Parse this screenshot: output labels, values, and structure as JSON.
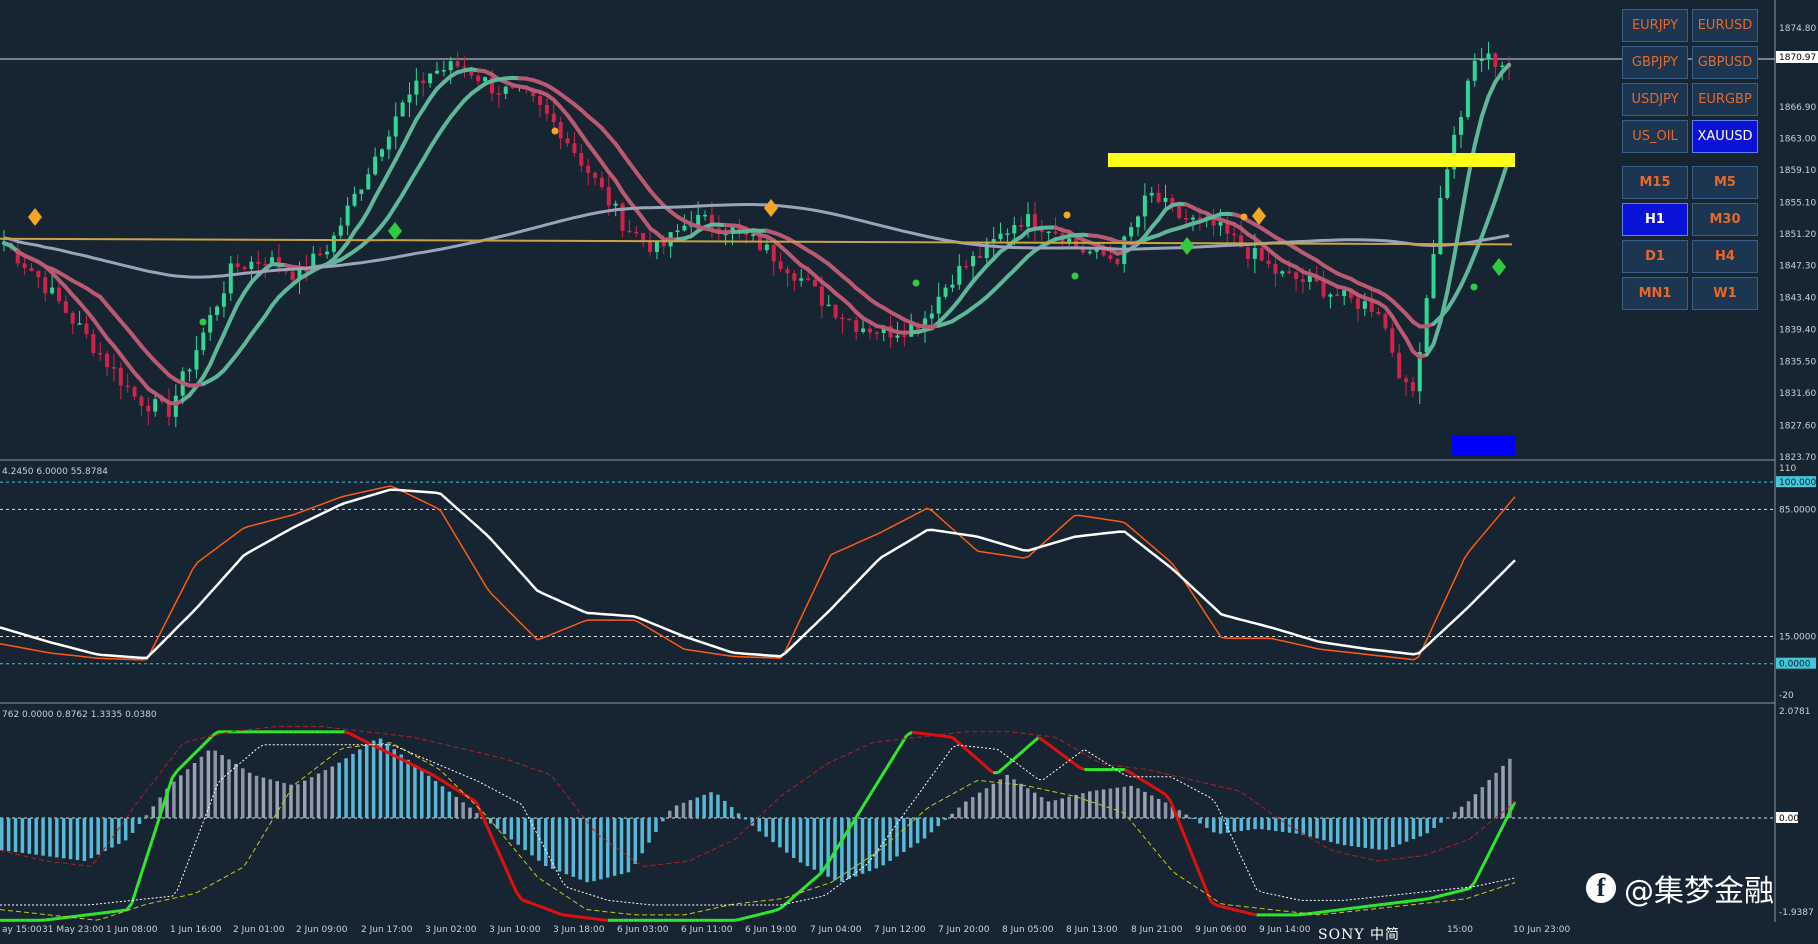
{
  "symbols": [
    {
      "label": "EURJPY",
      "active": false
    },
    {
      "label": "EURUSD",
      "active": false
    },
    {
      "label": "GBPJPY",
      "active": false
    },
    {
      "label": "GBPUSD",
      "active": false
    },
    {
      "label": "USDJPY",
      "active": false
    },
    {
      "label": "EURGBP",
      "active": false
    },
    {
      "label": "US_OIL",
      "active": false
    },
    {
      "label": "XAUUSD",
      "active": true
    }
  ],
  "timeframes": [
    {
      "label": "M15",
      "active": false
    },
    {
      "label": "M5",
      "active": false
    },
    {
      "label": "H1",
      "active": true
    },
    {
      "label": "M30",
      "active": false
    },
    {
      "label": "D1",
      "active": false
    },
    {
      "label": "H4",
      "active": false
    },
    {
      "label": "MN1",
      "active": false
    },
    {
      "label": "W1",
      "active": false
    }
  ],
  "price_axis": {
    "labels": [
      "1874.80",
      "1870.97",
      "1866.90",
      "1863.00",
      "1859.10",
      "1855.10",
      "1851.20",
      "1847.30",
      "1843.40",
      "1839.40",
      "1835.50",
      "1831.60",
      "1827.60",
      "1823.70"
    ],
    "current": "1870.97"
  },
  "stoch_panel": {
    "header": "4.2450 6.0000 55.8784",
    "axis": [
      "110",
      "100.0000",
      "85.0000",
      "15.0000",
      "0.0000",
      "-20"
    ]
  },
  "macd_panel": {
    "header": "762 0.0000 0.8762 1.3335 0.0380",
    "axis": [
      "2.0781",
      "0.00",
      "-1.9387"
    ]
  },
  "time_axis": [
    "ay 15:00",
    "31 May 23:00",
    "1 Jun 08:00",
    "1 Jun 16:00",
    "2 Jun 01:00",
    "2 Jun 09:00",
    "2 Jun 17:00",
    "3 Jun 02:00",
    "3 Jun 10:00",
    "3 Jun 18:00",
    "6 Jun 03:00",
    "6 Jun 11:00",
    "6 Jun 19:00",
    "7 Jun 04:00",
    "7 Jun 12:00",
    "7 Jun 20:00",
    "8 Jun 05:00",
    "8 Jun 13:00",
    "8 Jun 21:00",
    "9 Jun 06:00",
    "9 Jun 14:00",
    "15:00",
    "10 Jun 23:00"
  ],
  "watermark": {
    "text": "@集梦金融",
    "logo": "facebook-icon",
    "overlay": "SONY 中简"
  },
  "colors": {
    "bg": "#172532",
    "bull": "#2fd894",
    "bear": "#d1234a",
    "signal_yellow": "#ffff1a",
    "signal_blue": "#0000ff",
    "diamond": "#f5a623",
    "diamond_green": "#2ecc40"
  },
  "chart_data": {
    "type": "candlestick",
    "symbol": "XAUUSD",
    "timeframe": "H1",
    "ylim": [
      1823.7,
      1876.5
    ],
    "price_keypoints": [
      1850,
      1846,
      1841,
      1836,
      1831,
      1829,
      1838,
      1847,
      1848,
      1846,
      1850,
      1858,
      1866,
      1871,
      1872,
      1869,
      1868,
      1864,
      1858,
      1852,
      1849,
      1853,
      1852,
      1850,
      1847,
      1843,
      1840,
      1839,
      1840,
      1846,
      1849,
      1853,
      1852,
      1849,
      1848,
      1856,
      1853,
      1852,
      1849,
      1846,
      1845,
      1843,
      1842,
      1830,
      1858,
      1873,
      1872
    ],
    "stochastic": {
      "levels": [
        100,
        85,
        15,
        0
      ],
      "ylim": [
        -20,
        110
      ]
    },
    "macd": {
      "ylim": [
        -1.9387,
        2.0781
      ]
    }
  }
}
